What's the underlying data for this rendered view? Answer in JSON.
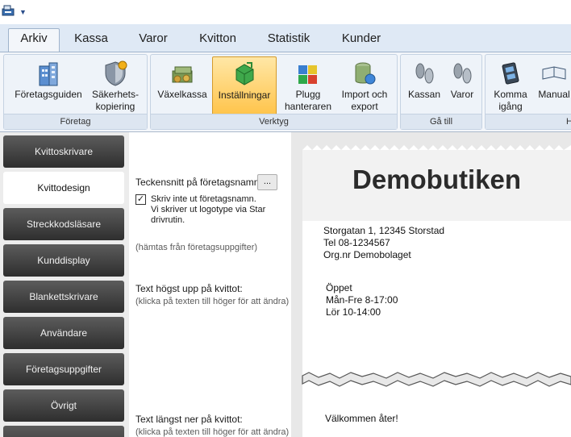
{
  "ribbon_tabs": [
    "Arkiv",
    "Kassa",
    "Varor",
    "Kvitton",
    "Statistik",
    "Kunder"
  ],
  "ribbon": {
    "foretag": {
      "label": "Företag",
      "foretagsguiden": "Företagsguiden",
      "sakerhet_line1": "Säkerhets-",
      "sakerhet_line2": "kopiering"
    },
    "verktyg": {
      "label": "Verktyg",
      "vaxelkassa": "Växelkassa",
      "installningar": "Inställningar",
      "plugg_line1": "Plugg",
      "plugg_line2": "hanteraren",
      "import_line1": "Import och",
      "import_line2": "export"
    },
    "ga_till": {
      "label": "Gå till",
      "kassan": "Kassan",
      "varor": "Varor"
    },
    "hjalp": {
      "label_partial": "H",
      "komma_line1": "Komma",
      "komma_line2": "igång",
      "manual": "Manual"
    }
  },
  "nav": [
    "Kvittoskrivare",
    "Kvittodesign",
    "Streckkodsläsare",
    "Kunddisplay",
    "Blankettskrivare",
    "Användare",
    "Företagsuppgifter",
    "Övrigt"
  ],
  "settings": {
    "font_label": "Teckensnitt på företagsnamn:",
    "font_button": "...",
    "checkbox_checked": true,
    "checkbox_line1": "Skriv inte ut företagsnamn.",
    "checkbox_line2": "Vi skriver ut logotype via Star",
    "checkbox_line3": "drivrutin.",
    "fetched_hint": "(hämtas från företagsuppgifter)",
    "top_text_label": "Text högst upp på kvittot:",
    "top_text_hint": "(klicka på texten till höger för att ändra)",
    "bottom_text_label": "Text längst ner på kvittot:",
    "bottom_text_hint": "(klicka på texten till höger för att ändra)"
  },
  "receipt": {
    "company_name": "Demobutiken",
    "address": "Storgatan 1, 12345 Storstad",
    "phone": "Tel 08-1234567",
    "org": "Org.nr Demobolaget",
    "hours_title": "Öppet",
    "hours_weekday": "Mån-Fre 8-17:00",
    "hours_saturday": "Lör 10-14:00",
    "footer": "Välkommen åter!"
  }
}
